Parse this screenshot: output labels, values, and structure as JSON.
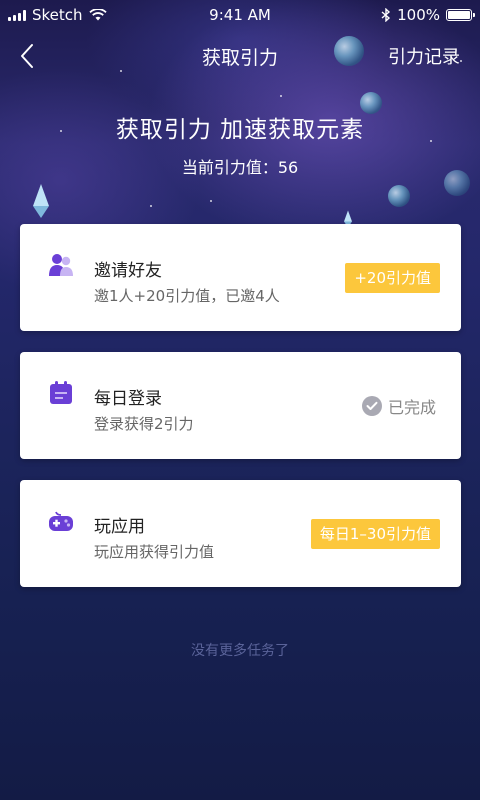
{
  "status_bar": {
    "carrier": "Sketch",
    "time": "9:41 AM",
    "battery": "100%"
  },
  "nav": {
    "title": "获取引力",
    "right_link": "引力记录"
  },
  "hero": {
    "title": "获取引力 加速获取元素",
    "current_value": "当前引力值：56"
  },
  "tasks": [
    {
      "title": "邀请好友",
      "desc": "邀1人+20引力值，已邀4人",
      "badge": "+20引力值",
      "icon": "users-icon"
    },
    {
      "title": "每日登录",
      "desc": "登录获得2引力",
      "status": "已完成",
      "icon": "calendar-icon"
    },
    {
      "title": "玩应用",
      "desc": "玩应用获得引力值",
      "badge": "每日1–30引力值",
      "icon": "gamepad-icon"
    }
  ],
  "footer": {
    "note": "没有更多任务了"
  },
  "colors": {
    "accent_badge": "#fcc73c",
    "icon_purple": "#6a3fd6",
    "done_gray": "#a9a9b3"
  }
}
